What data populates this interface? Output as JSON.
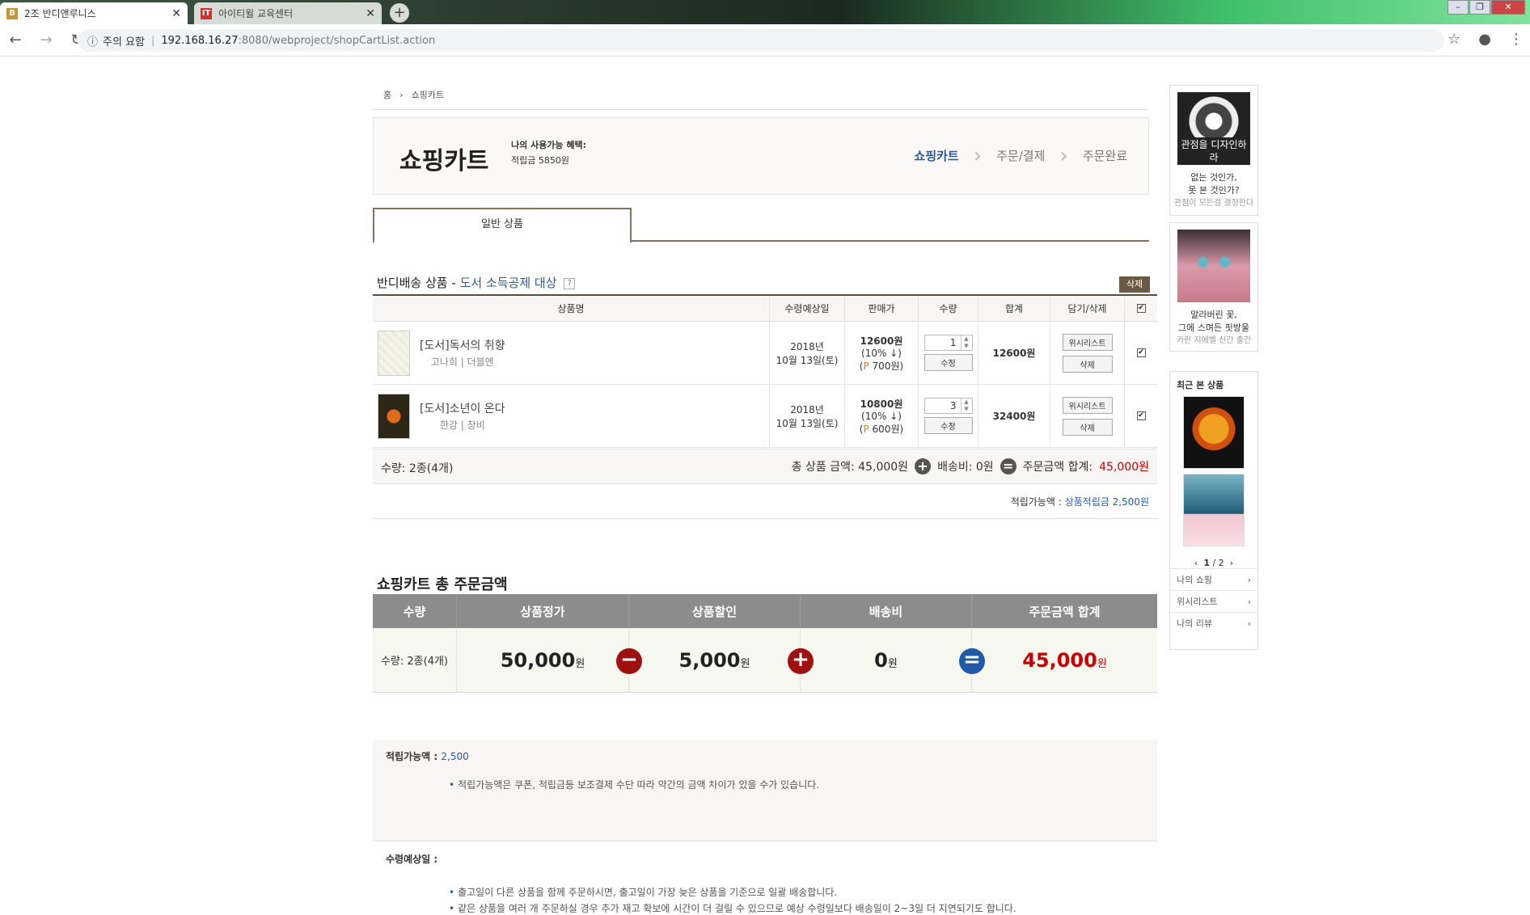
{
  "browser": {
    "tabs": [
      {
        "title": "2조 반디앤루니스",
        "favicon": "B",
        "active": true
      },
      {
        "title": "아이티윌 교육센터",
        "favicon": "IT",
        "active": false
      }
    ],
    "security": "주의 요함",
    "url_host": "192.168.16.27",
    "url_path": ":8080/webproject/shopCartList.action"
  },
  "breadcrumb": {
    "home": "홈",
    "current": "쇼핑카트"
  },
  "header": {
    "title": "쇼핑카트",
    "benefit_label": "나의 사용가능 혜택:",
    "benefit_value": "적립금 5850원",
    "steps": [
      "쇼핑카트",
      "주문/결제",
      "주문완료"
    ]
  },
  "tab": {
    "label": "일반 상품"
  },
  "section": {
    "title": "반디배송 상품",
    "dash": "-",
    "tax_label": "도서 소득공제 대상",
    "help": "?",
    "delete_label": "삭제"
  },
  "cart": {
    "columns": [
      "상품명",
      "수령예상일",
      "판매가",
      "수량",
      "합계",
      "담기/삭제"
    ],
    "items": [
      {
        "name": "[도서]독서의 취향",
        "author": "고나희 | 더블엔",
        "date1": "2018년",
        "date2": "10월 13일(토)",
        "price": "12600원",
        "discount": "(10% ↓)",
        "point_p": "P",
        "point": " 700원)",
        "qty": "1",
        "total": "12600원"
      },
      {
        "name": "[도서]소년이 온다",
        "author": "한강 | 창비",
        "date1": "2018년",
        "date2": "10월 13일(토)",
        "price": "10800원",
        "discount": "(10% ↓)",
        "point_p": "P",
        "point": " 600원)",
        "qty": "3",
        "total": "32400원"
      }
    ],
    "edit_label": "수정",
    "wish_label": "위시리스트",
    "remove_label": "삭제",
    "open_paren": "("
  },
  "summary": {
    "count": "수량: 2종(4개)",
    "goods_label": "총 상품 금액: 45,000원",
    "ship_label": "배송비: 0원",
    "order_label": "주문금액 합계:",
    "order_value": "45,000원",
    "point_label": "적립가능액 :",
    "point_value": "상품적립금 2,500원"
  },
  "total": {
    "title": "쇼핑카트 총 주문금액",
    "headers": [
      "수량",
      "상품정가",
      "상품할인",
      "배송비",
      "주문금액 합계"
    ],
    "count": "수량: 2종(4개)",
    "list_price": "50,000",
    "discount": "5,000",
    "shipping": "0",
    "order_total": "45,000",
    "won": "원"
  },
  "notes": {
    "point_label": "적립가능액 :",
    "point_value": "2,500",
    "point_note": "적립가능액은 쿠폰, 적립금등 보조결제 수단 따라 약간의 금액 차이가 있을 수가 있습니다.",
    "date_label": "수령예상일 :",
    "date_note1": "출고일이 다른 상품을 함께 주문하시면, 출고일이 가장 늦은 상품을 기준으로 일괄 배송합니다.",
    "date_note2": "같은 상품을 여러 개 주문하실 경우 추가 재고 확보에 시간이 더 걸릴 수 있으므로 예상 수령일보다 배송일이 2~3일 더 지연되기도 합니다."
  },
  "sidebar": {
    "ad1": {
      "cover": "관점을 디자인하라",
      "line1": "없는 것인가,",
      "line2": "못 본 것인가?",
      "line3": "관점이 모든걸 결정한다"
    },
    "ad2": {
      "line1": "말라버린 꽃,",
      "line2": "그에 스며든 핏방울",
      "line3": "카린 지에벨 신간 출간"
    },
    "recent_title": "최근 본 상품",
    "pager_current": "1",
    "pager_total": "/ 2",
    "links": [
      "나의 쇼핑",
      "위시리스트",
      "나의 리뷰"
    ]
  }
}
